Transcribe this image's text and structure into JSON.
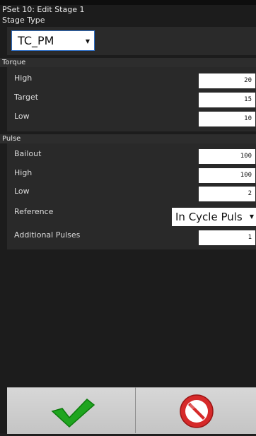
{
  "header": {
    "title": "PSet 10: Edit Stage 1"
  },
  "stage_type": {
    "label": "Stage Type",
    "value": "TC_PM"
  },
  "torque": {
    "header": "Torque",
    "rows": [
      {
        "label": "High",
        "value": "20"
      },
      {
        "label": "Target",
        "value": "15"
      },
      {
        "label": "Low",
        "value": "10"
      }
    ]
  },
  "pulse": {
    "header": "Pulse",
    "rows": [
      {
        "label": "Bailout",
        "value": "100"
      },
      {
        "label": "High",
        "value": "100"
      },
      {
        "label": "Low",
        "value": "2"
      }
    ],
    "reference": {
      "label": "Reference",
      "value": "In Cycle Puls"
    },
    "additional": {
      "label": "Additional Pulses",
      "value": "1"
    }
  },
  "colors": {
    "ok": "#1fa51f",
    "cancel": "#d62a2a"
  },
  "icons": {
    "ok": "checkmark-icon",
    "cancel": "no-entry-icon",
    "dropdown": "triangle-down-icon"
  }
}
